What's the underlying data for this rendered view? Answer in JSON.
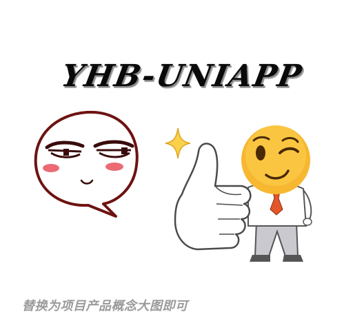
{
  "header": {
    "title": "YHB-UNIAPP"
  },
  "footer": {
    "caption": "替换为项目产品概念大图即可"
  },
  "icons": {
    "left": "smug-face-speech-bubble-icon",
    "sparkle": "sparkle-icon",
    "right": "winking-emoji-thumbs-up-icon"
  },
  "colors": {
    "background": "#ffffff",
    "title": "#0a0a0a",
    "caption": "#9a9a9a",
    "emoji_yellow": "#f7b731",
    "tie": "#e2562a",
    "blush": "#e8505b"
  }
}
